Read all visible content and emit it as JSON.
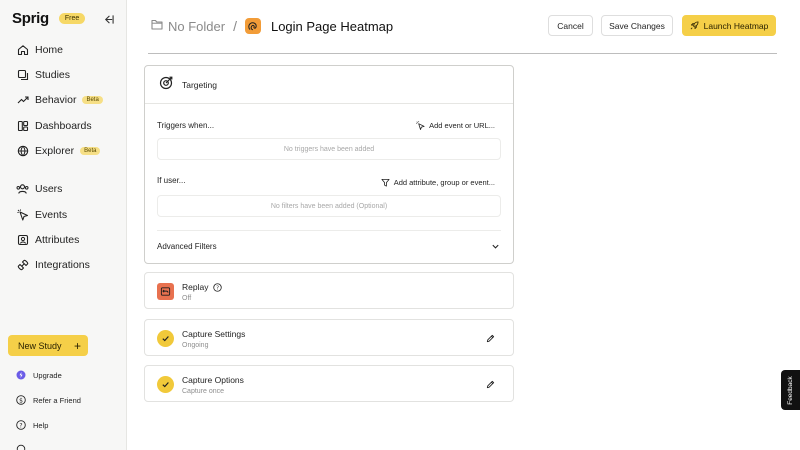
{
  "sidebar": {
    "logo": "Sprig",
    "plan_badge": "Free",
    "nav": [
      {
        "label": "Home",
        "icon": "home-icon"
      },
      {
        "label": "Studies",
        "icon": "studies-icon"
      },
      {
        "label": "Behavior",
        "icon": "trend-icon",
        "badge": "Beta"
      },
      {
        "label": "Dashboards",
        "icon": "dashboards-icon"
      },
      {
        "label": "Explorer",
        "icon": "explorer-icon",
        "badge": "Beta"
      },
      {
        "label": "Users",
        "icon": "users-icon"
      },
      {
        "label": "Events",
        "icon": "events-icon"
      },
      {
        "label": "Attributes",
        "icon": "attributes-icon"
      },
      {
        "label": "Integrations",
        "icon": "integrations-icon"
      }
    ],
    "new_study": "New Study",
    "footer": [
      {
        "label": "Upgrade",
        "icon": "upgrade-icon"
      },
      {
        "label": "Refer a Friend",
        "icon": "dollar-icon"
      },
      {
        "label": "Help",
        "icon": "help-icon"
      }
    ]
  },
  "header": {
    "folder": "No Folder",
    "separator": "/",
    "title": "Login Page Heatmap",
    "cancel": "Cancel",
    "save": "Save Changes",
    "launch": "Launch Heatmap"
  },
  "targeting": {
    "title": "Targeting",
    "triggers_label": "Triggers when...",
    "triggers_action": "Add event or URL...",
    "triggers_empty": "No triggers have been added",
    "filters_label": "If user...",
    "filters_action": "Add attribute, group or event...",
    "filters_empty": "No filters have been added (Optional)",
    "advanced": "Advanced Filters"
  },
  "replay": {
    "title": "Replay",
    "status": "Off"
  },
  "capture_settings": {
    "title": "Capture Settings",
    "status": "Ongoing"
  },
  "capture_options": {
    "title": "Capture Options",
    "status": "Capture once"
  },
  "feedback": "Feedback",
  "colors": {
    "accent": "#f5cf48",
    "replay_icon": "#e8714f",
    "heatmap_icon": "#f29c38"
  }
}
